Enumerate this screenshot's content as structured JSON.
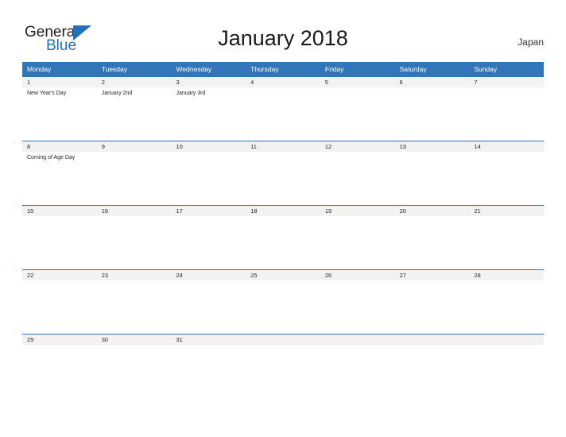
{
  "logo": {
    "line1": "General",
    "line2": "Blue",
    "triangle_icon": "triangle-icon",
    "accent_color": "#1f72b8",
    "text_color": "#231f20"
  },
  "header": {
    "title": "January 2018",
    "country": "Japan"
  },
  "theme": {
    "header_blue": "#3275b8",
    "band_gray": "#f2f2f2",
    "row_border": "#2e75b6",
    "background": "#ffffff"
  },
  "calendar": {
    "weekdays": [
      "Monday",
      "Tuesday",
      "Wednesday",
      "Thursday",
      "Friday",
      "Saturday",
      "Sunday"
    ],
    "weeks": [
      {
        "days": [
          {
            "date": "1",
            "event": "New Year's Day"
          },
          {
            "date": "2",
            "event": "January 2nd"
          },
          {
            "date": "3",
            "event": "January 3rd"
          },
          {
            "date": "4",
            "event": ""
          },
          {
            "date": "5",
            "event": ""
          },
          {
            "date": "6",
            "event": ""
          },
          {
            "date": "7",
            "event": ""
          }
        ]
      },
      {
        "days": [
          {
            "date": "8",
            "event": "Coming of Age Day"
          },
          {
            "date": "9",
            "event": ""
          },
          {
            "date": "10",
            "event": ""
          },
          {
            "date": "11",
            "event": ""
          },
          {
            "date": "12",
            "event": ""
          },
          {
            "date": "13",
            "event": ""
          },
          {
            "date": "14",
            "event": ""
          }
        ]
      },
      {
        "days": [
          {
            "date": "15",
            "event": ""
          },
          {
            "date": "16",
            "event": ""
          },
          {
            "date": "17",
            "event": ""
          },
          {
            "date": "18",
            "event": ""
          },
          {
            "date": "19",
            "event": ""
          },
          {
            "date": "20",
            "event": ""
          },
          {
            "date": "21",
            "event": ""
          }
        ]
      },
      {
        "days": [
          {
            "date": "22",
            "event": ""
          },
          {
            "date": "23",
            "event": ""
          },
          {
            "date": "24",
            "event": ""
          },
          {
            "date": "25",
            "event": ""
          },
          {
            "date": "26",
            "event": ""
          },
          {
            "date": "27",
            "event": ""
          },
          {
            "date": "28",
            "event": ""
          }
        ]
      },
      {
        "days": [
          {
            "date": "29",
            "event": ""
          },
          {
            "date": "30",
            "event": ""
          },
          {
            "date": "31",
            "event": ""
          },
          {
            "date": "",
            "event": ""
          },
          {
            "date": "",
            "event": ""
          },
          {
            "date": "",
            "event": ""
          },
          {
            "date": "",
            "event": ""
          }
        ]
      }
    ]
  }
}
